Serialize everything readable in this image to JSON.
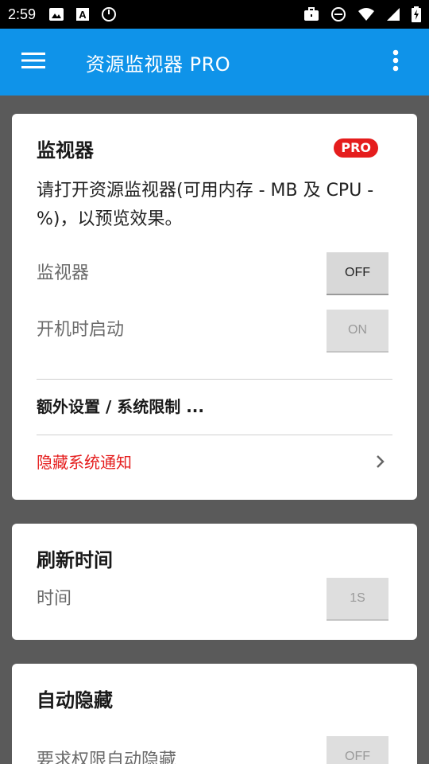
{
  "status_bar": {
    "time": "2:59",
    "left_icons": [
      "image-icon",
      "font-icon",
      "power-icon"
    ],
    "right_icons": [
      "briefcase-icon",
      "dnd-icon",
      "wifi-icon",
      "signal-icon",
      "battery-charging-icon"
    ]
  },
  "app_bar": {
    "title": "资源监视器 PRO",
    "menu_icon": "hamburger-menu-icon",
    "more_icon": "more-vert-icon",
    "color": "#0f93e9"
  },
  "monitor_card": {
    "title": "监视器",
    "badge": "PRO",
    "description": "请打开资源监视器(可用内存 - MB 及 CPU - %)，以预览效果。",
    "rows": [
      {
        "label": "监视器",
        "toggle": "OFF"
      },
      {
        "label": "开机时启动",
        "toggle": "ON"
      }
    ],
    "extra_settings": "额外设置 / 系统限制 ...",
    "hide_notification": "隐藏系统通知"
  },
  "refresh_card": {
    "title": "刷新时间",
    "row_label": "时间",
    "value": "1S"
  },
  "autohide_card": {
    "title": "自动隐藏",
    "row_label": "要求权限自动隐藏",
    "toggle": "OFF"
  },
  "colors": {
    "accent": "#0f93e9",
    "pro_badge": "#e51d1d",
    "warning_text": "#e51d1d"
  }
}
